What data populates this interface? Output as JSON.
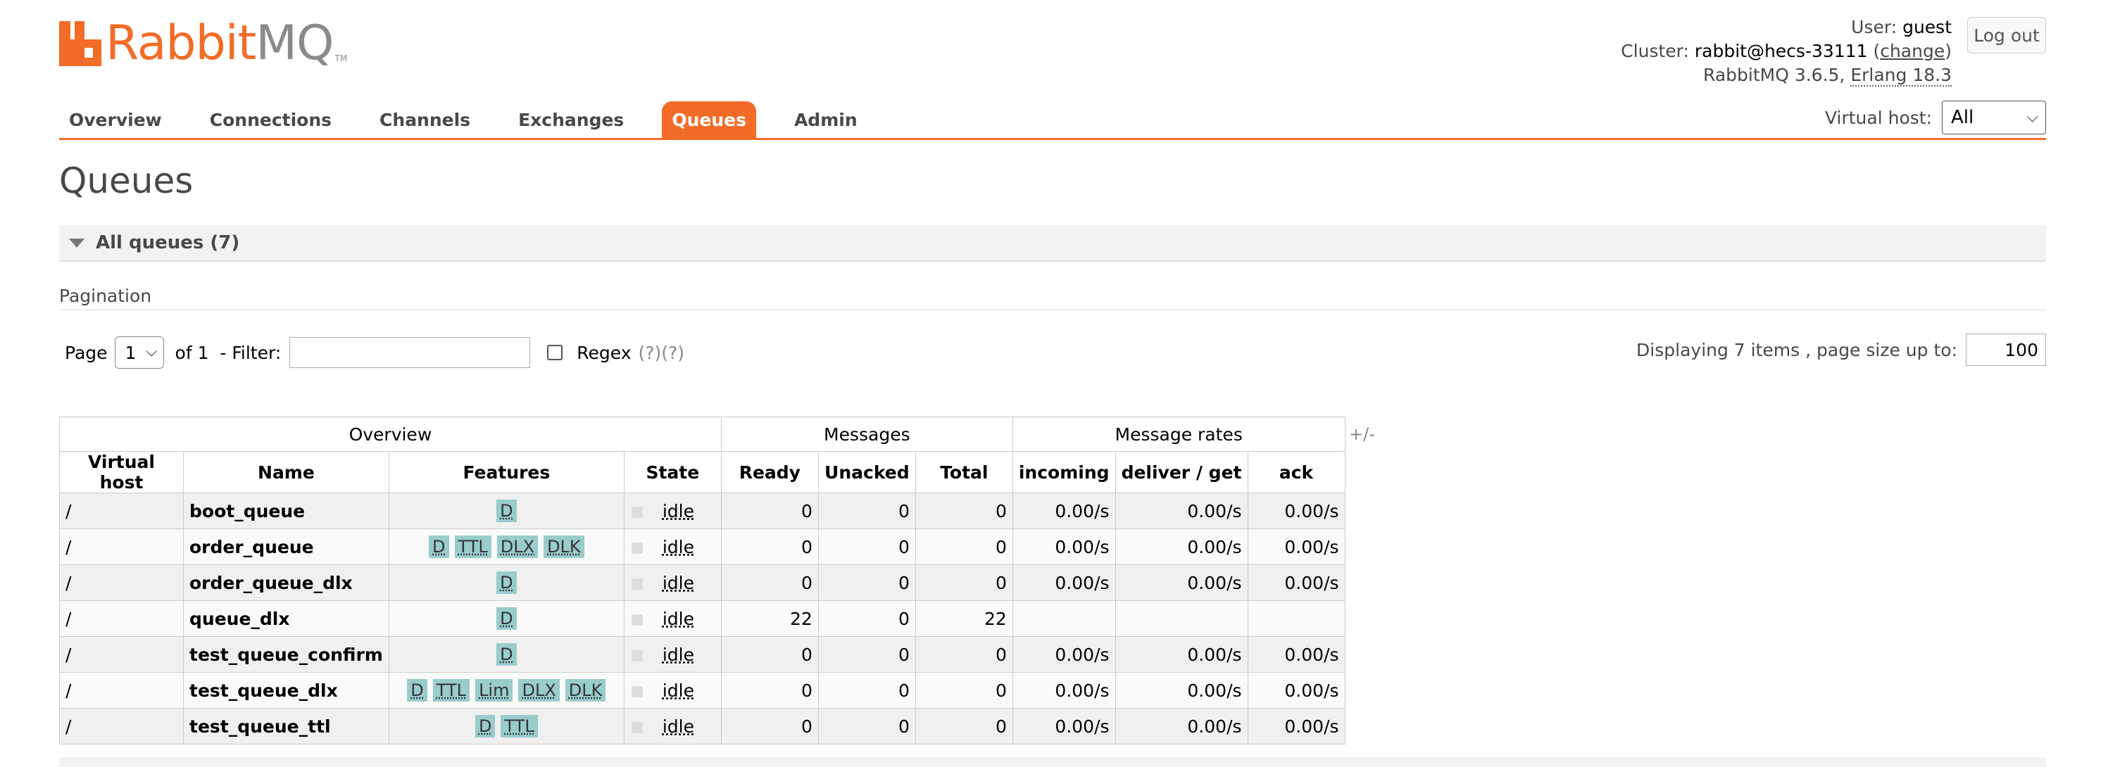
{
  "header": {
    "logo_text": "Rabbit",
    "logo_mq": "MQ",
    "logo_tm": "TM",
    "user_label": "User:",
    "user": "guest",
    "cluster_label": "Cluster:",
    "cluster": "rabbit@hecs-33111",
    "change_link": "change",
    "version_prefix": "RabbitMQ 3.6.5, ",
    "erlang": "Erlang 18.3",
    "logout": "Log out"
  },
  "nav": {
    "tabs": [
      "Overview",
      "Connections",
      "Channels",
      "Exchanges",
      "Queues",
      "Admin"
    ],
    "active": "Queues"
  },
  "vhost": {
    "label": "Virtual host:",
    "value": "All"
  },
  "page": {
    "title": "Queues",
    "section": "All queues (7)",
    "pagination_label": "Pagination",
    "page_label": "Page",
    "page_value": "1",
    "of_label": "of 1  - Filter:",
    "regex_label": "Regex",
    "regex_help": "(?)(?)",
    "display_label": "Displaying 7 items , page size up to:",
    "page_size": "100"
  },
  "table": {
    "groups": [
      "Overview",
      "Messages",
      "Message rates"
    ],
    "plus_minus": "+/-",
    "columns": [
      "Virtual host",
      "Name",
      "Features",
      "State",
      "Ready",
      "Unacked",
      "Total",
      "incoming",
      "deliver / get",
      "ack"
    ],
    "rows": [
      {
        "vhost": "/",
        "name": "boot_queue",
        "features": [
          "D"
        ],
        "state": "idle",
        "ready": "0",
        "unacked": "0",
        "total": "0",
        "incoming": "0.00/s",
        "deliver": "0.00/s",
        "ack": "0.00/s"
      },
      {
        "vhost": "/",
        "name": "order_queue",
        "features": [
          "D",
          "TTL",
          "DLX",
          "DLK"
        ],
        "state": "idle",
        "ready": "0",
        "unacked": "0",
        "total": "0",
        "incoming": "0.00/s",
        "deliver": "0.00/s",
        "ack": "0.00/s"
      },
      {
        "vhost": "/",
        "name": "order_queue_dlx",
        "features": [
          "D"
        ],
        "state": "idle",
        "ready": "0",
        "unacked": "0",
        "total": "0",
        "incoming": "0.00/s",
        "deliver": "0.00/s",
        "ack": "0.00/s"
      },
      {
        "vhost": "/",
        "name": "queue_dlx",
        "features": [
          "D"
        ],
        "state": "idle",
        "ready": "22",
        "unacked": "0",
        "total": "22",
        "incoming": "",
        "deliver": "",
        "ack": ""
      },
      {
        "vhost": "/",
        "name": "test_queue_confirm",
        "features": [
          "D"
        ],
        "state": "idle",
        "ready": "0",
        "unacked": "0",
        "total": "0",
        "incoming": "0.00/s",
        "deliver": "0.00/s",
        "ack": "0.00/s"
      },
      {
        "vhost": "/",
        "name": "test_queue_dlx",
        "features": [
          "D",
          "TTL",
          "Lim",
          "DLX",
          "DLK"
        ],
        "state": "idle",
        "ready": "0",
        "unacked": "0",
        "total": "0",
        "incoming": "0.00/s",
        "deliver": "0.00/s",
        "ack": "0.00/s"
      },
      {
        "vhost": "/",
        "name": "test_queue_ttl",
        "features": [
          "D",
          "TTL"
        ],
        "state": "idle",
        "ready": "0",
        "unacked": "0",
        "total": "0",
        "incoming": "0.00/s",
        "deliver": "0.00/s",
        "ack": "0.00/s"
      }
    ]
  },
  "colors": {
    "accent": "#f26c28",
    "badge": "#99cccc"
  }
}
